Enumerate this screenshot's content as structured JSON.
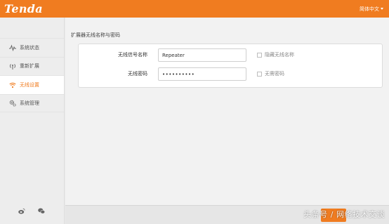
{
  "header": {
    "logo": "Tenda",
    "language": "简体中文"
  },
  "sidebar": {
    "items": [
      {
        "label": "系统状态",
        "icon": "pulse-icon",
        "active": false
      },
      {
        "label": "重新扩展",
        "icon": "antenna-icon",
        "active": false
      },
      {
        "label": "无线设置",
        "icon": "wifi-icon",
        "active": true
      },
      {
        "label": "系统管理",
        "icon": "gear-icon",
        "active": false
      }
    ],
    "footer_icons": [
      "weibo-icon",
      "wechat-icon"
    ]
  },
  "main": {
    "section_title": "扩展器无线名称与密码",
    "ssid": {
      "label": "无线信号名称",
      "value": "Repeater",
      "checkbox_label": "隐藏无线名称",
      "checked": false
    },
    "password": {
      "label": "无线密码",
      "value": "••••••••••",
      "checkbox_label": "无需密码",
      "checked": false
    }
  },
  "footer": {
    "watermark": "头条号 / 网络技术交谈"
  },
  "colors": {
    "accent": "#f07c20",
    "sidebar_bg": "#ededed",
    "main_bg": "#f2f2f2"
  }
}
